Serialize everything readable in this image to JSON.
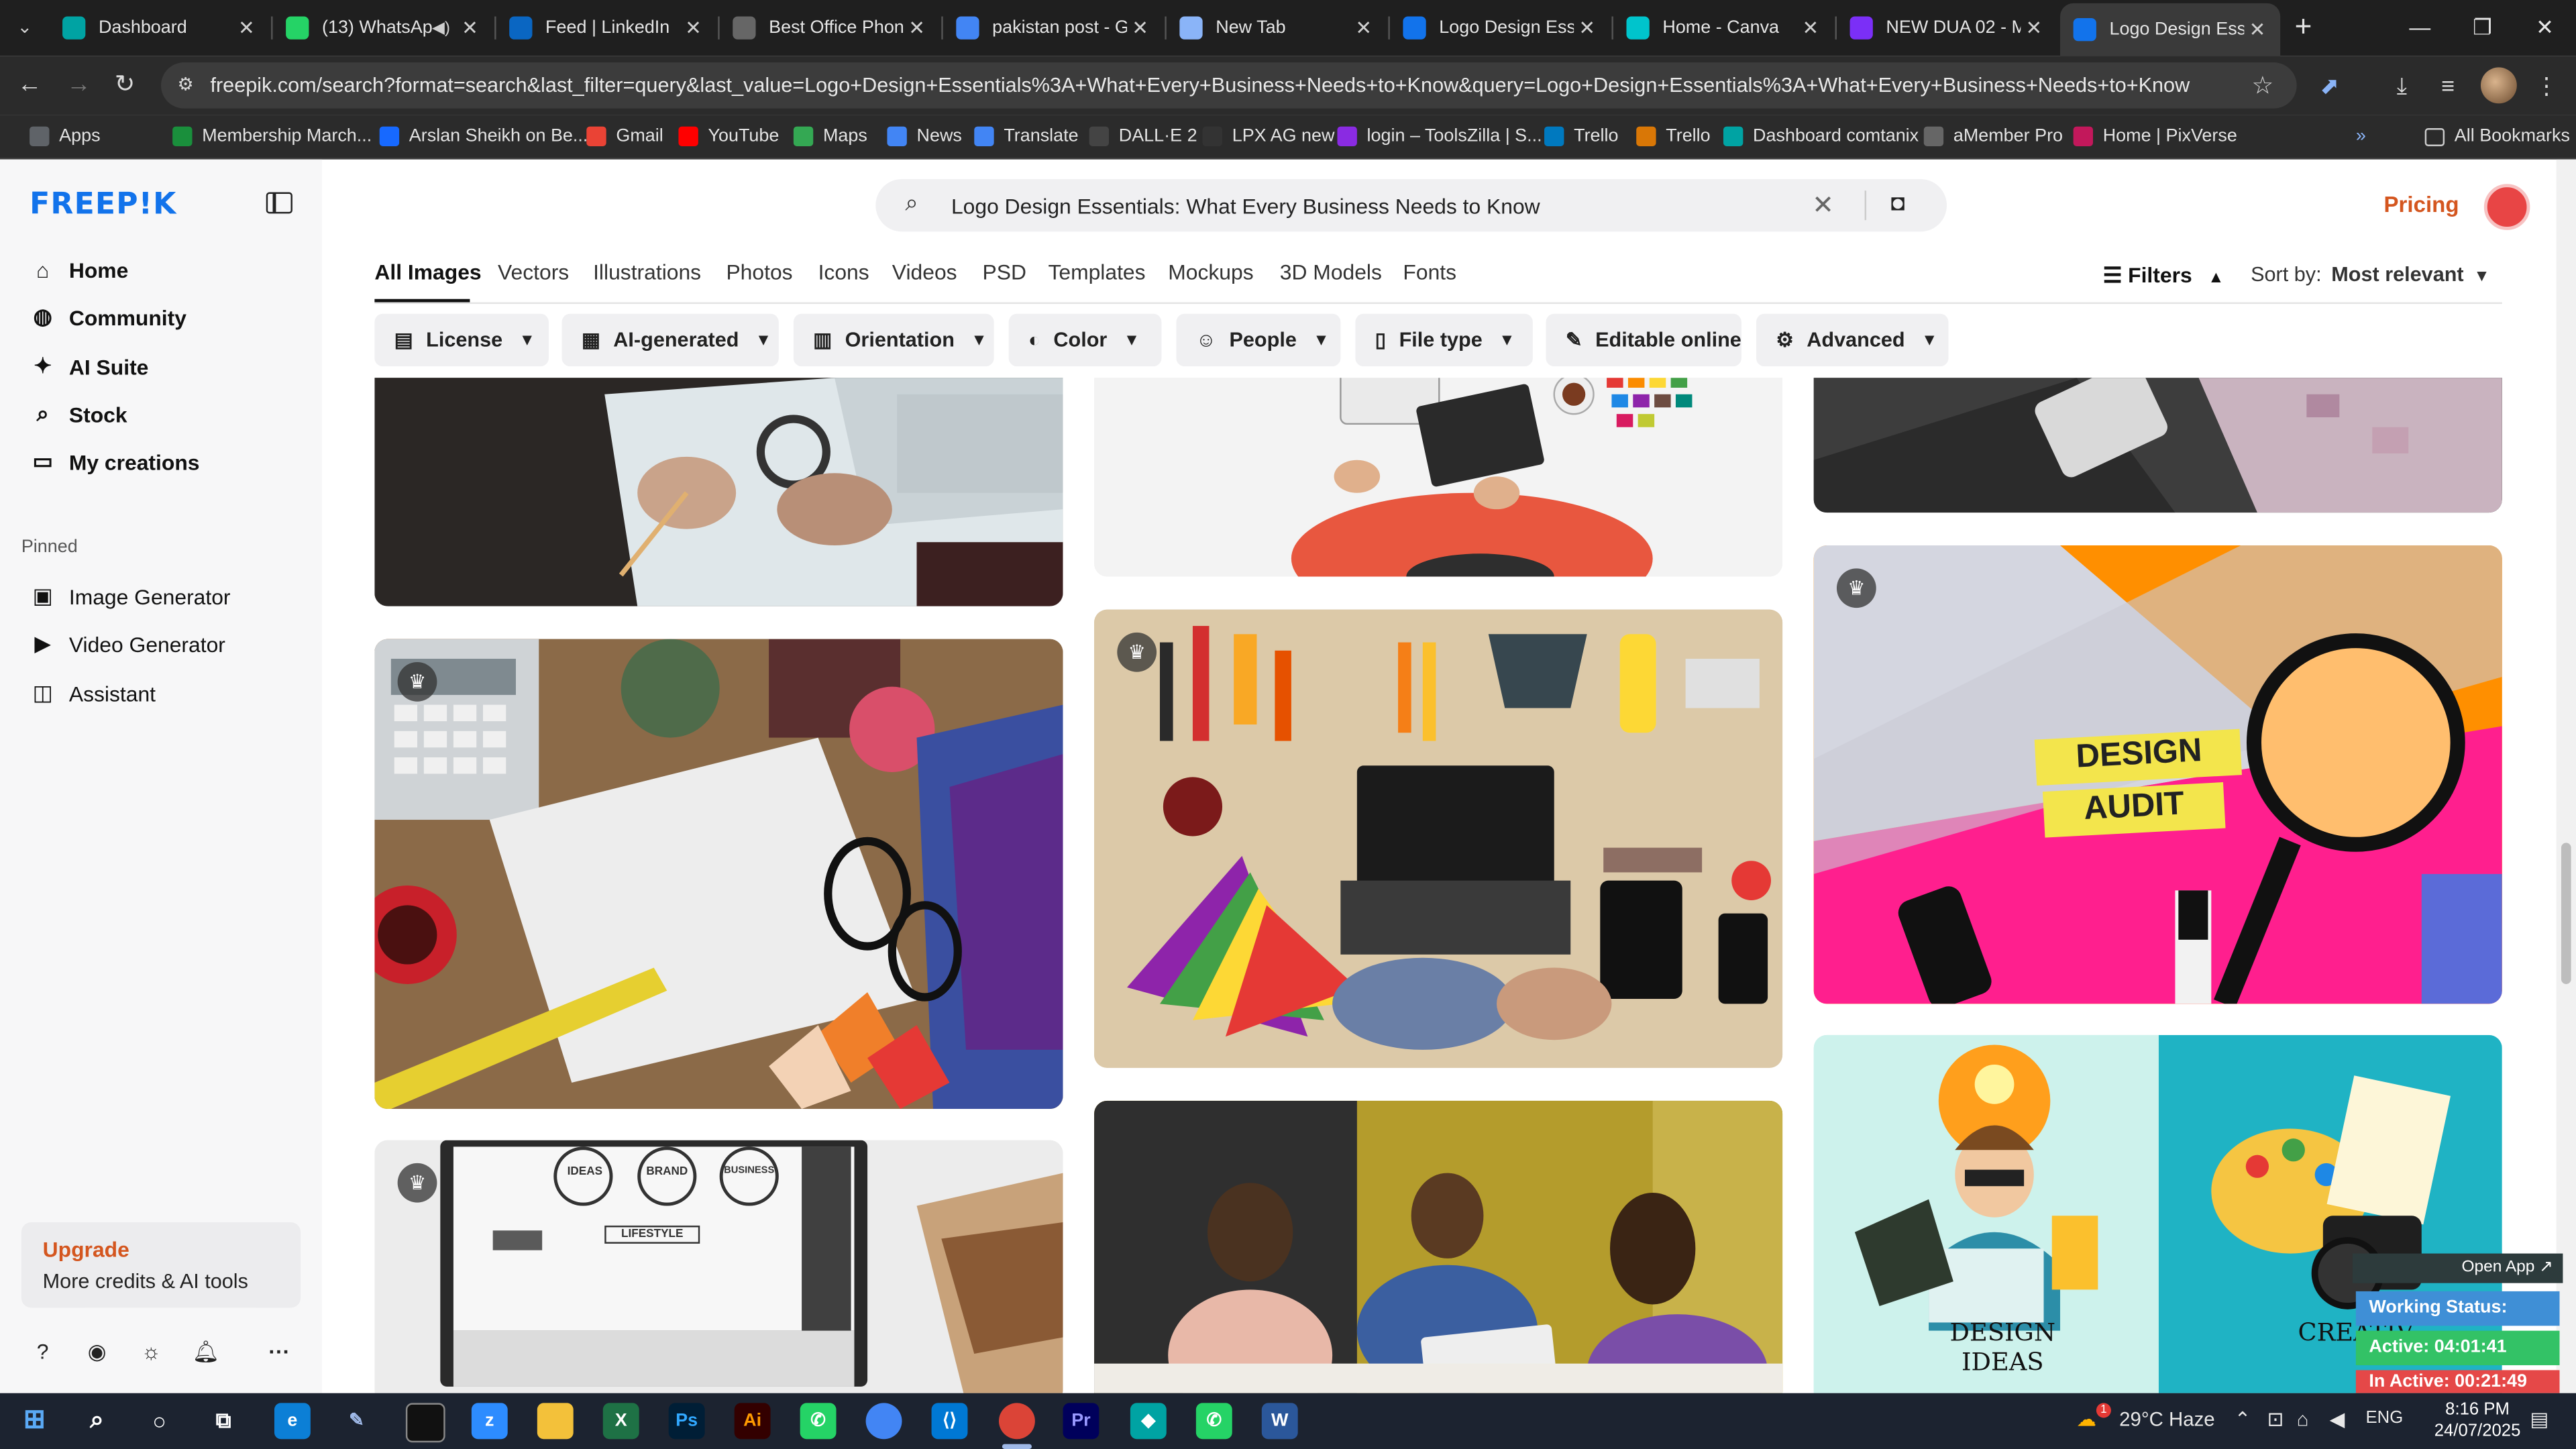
{
  "browser": {
    "tabs": [
      {
        "title": "Dashboard",
        "icon": "dashboard-icon",
        "color": "#00a3a3"
      },
      {
        "title": "(13) WhatsApp",
        "icon": "whatsapp-icon",
        "color": "#25d366",
        "audio": true
      },
      {
        "title": "Feed | LinkedIn",
        "icon": "linkedin-icon",
        "color": "#0a66c2"
      },
      {
        "title": "Best Office Phone",
        "icon": "site-icon",
        "color": "#666666"
      },
      {
        "title": "pakistan post - Go",
        "icon": "google-icon",
        "color": "#4285f4"
      },
      {
        "title": "New Tab",
        "icon": "chrome-icon",
        "color": "#8ab4f8"
      },
      {
        "title": "Logo Design Esse",
        "icon": "freepik-icon",
        "color": "#1273eb"
      },
      {
        "title": "Home - Canva",
        "icon": "canva-icon",
        "color": "#00c4cc"
      },
      {
        "title": "NEW DUA 02 - M",
        "icon": "video-icon",
        "color": "#7b2ff7"
      },
      {
        "title": "Logo Design Esse",
        "icon": "freepik-icon",
        "color": "#1273eb",
        "active": true
      }
    ],
    "url": "freepik.com/search?format=search&last_filter=query&last_value=Logo+Design+Essentials%3A+What+Every+Business+Needs+to+Know&query=Logo+Design+Essentials%3A+What+Every+Business+Needs+to+Know",
    "bookmarks": [
      {
        "label": "Apps",
        "icon": "apps-grid-icon",
        "color": "#5f6368"
      },
      {
        "label": "Membership March...",
        "icon": "membership-icon",
        "color": "#1a8f3c"
      },
      {
        "label": "Arslan Sheikh on Be...",
        "icon": "behance-icon",
        "color": "#1769ff"
      },
      {
        "label": "Gmail",
        "icon": "gmail-icon",
        "color": "#ea4335"
      },
      {
        "label": "YouTube",
        "icon": "youtube-icon",
        "color": "#ff0000"
      },
      {
        "label": "Maps",
        "icon": "maps-icon",
        "color": "#34a853"
      },
      {
        "label": "News",
        "icon": "news-icon",
        "color": "#4285f4"
      },
      {
        "label": "Translate",
        "icon": "translate-icon",
        "color": "#4285f4"
      },
      {
        "label": "DALL·E 2",
        "icon": "openai-icon",
        "color": "#444444"
      },
      {
        "label": "LPX AG new",
        "icon": "lpx-icon",
        "color": "#333333"
      },
      {
        "label": "login – ToolsZilla | S...",
        "icon": "toolszilla-icon",
        "color": "#8a2be2"
      },
      {
        "label": "Trello",
        "icon": "trello-icon",
        "color": "#0079bf"
      },
      {
        "label": "Trello",
        "icon": "trello-icon",
        "color": "#d97706"
      },
      {
        "label": "Dashboard comtanix",
        "icon": "comtanix-icon",
        "color": "#00a3a3"
      },
      {
        "label": "aMember Pro",
        "icon": "amember-icon",
        "color": "#666666"
      },
      {
        "label": "Home | PixVerse",
        "icon": "pixverse-icon",
        "color": "#c2185b"
      }
    ],
    "all_bookmarks_label": "All Bookmarks"
  },
  "sidebar": {
    "logo": "FREEP!K",
    "items": [
      {
        "label": "Home",
        "icon": "home-icon"
      },
      {
        "label": "Community",
        "icon": "globe-icon"
      },
      {
        "label": "AI Suite",
        "icon": "sparkle-icon"
      },
      {
        "label": "Stock",
        "icon": "search-icon"
      },
      {
        "label": "My creations",
        "icon": "folder-icon"
      }
    ],
    "pinned_label": "Pinned",
    "pinned": [
      {
        "label": "Image Generator",
        "icon": "image-icon"
      },
      {
        "label": "Video Generator",
        "icon": "video-icon"
      },
      {
        "label": "Assistant",
        "icon": "assistant-icon"
      }
    ],
    "upgrade_title": "Upgrade",
    "upgrade_sub": "More credits & AI tools"
  },
  "search": {
    "query": "Logo Design Essentials: What Every Business Needs to Know"
  },
  "header": {
    "pricing": "Pricing"
  },
  "categories": [
    "All Images",
    "Vectors",
    "Illustrations",
    "Photos",
    "Icons",
    "Videos",
    "PSD",
    "Templates",
    "Mockups",
    "3D Models",
    "Fonts"
  ],
  "filters_label": "Filters",
  "sort": {
    "label": "Sort by:",
    "value": "Most relevant"
  },
  "filter_buttons": [
    {
      "label": "License",
      "icon": "license-icon"
    },
    {
      "label": "AI-generated",
      "icon": "ai-icon"
    },
    {
      "label": "Orientation",
      "icon": "orientation-icon"
    },
    {
      "label": "Color",
      "icon": "palette-icon"
    },
    {
      "label": "People",
      "icon": "people-icon"
    },
    {
      "label": "File type",
      "icon": "file-icon"
    },
    {
      "label": "Editable online",
      "icon": "pencil-icon"
    },
    {
      "label": "Advanced",
      "icon": "gear-icon"
    }
  ],
  "gallery": {
    "badges": [
      "IDEAS",
      "BRAND",
      "BUSINESS",
      "LIFESTYLE"
    ],
    "design_audit": [
      "DESIGN",
      "AUDIT"
    ],
    "design_ideas": "DESIGN IDEAS",
    "creative": "CREATIV"
  },
  "work_status": {
    "open_app": "Open App ↗",
    "status": "Working Status: Active",
    "active": "Active: 04:01:41",
    "inactive": "In Active: 00:21:49"
  },
  "taskbar": {
    "weather": "29°C  Haze",
    "lang": "ENG",
    "time": "8:16 PM",
    "date": "24/07/2025",
    "notification_count": "1"
  }
}
